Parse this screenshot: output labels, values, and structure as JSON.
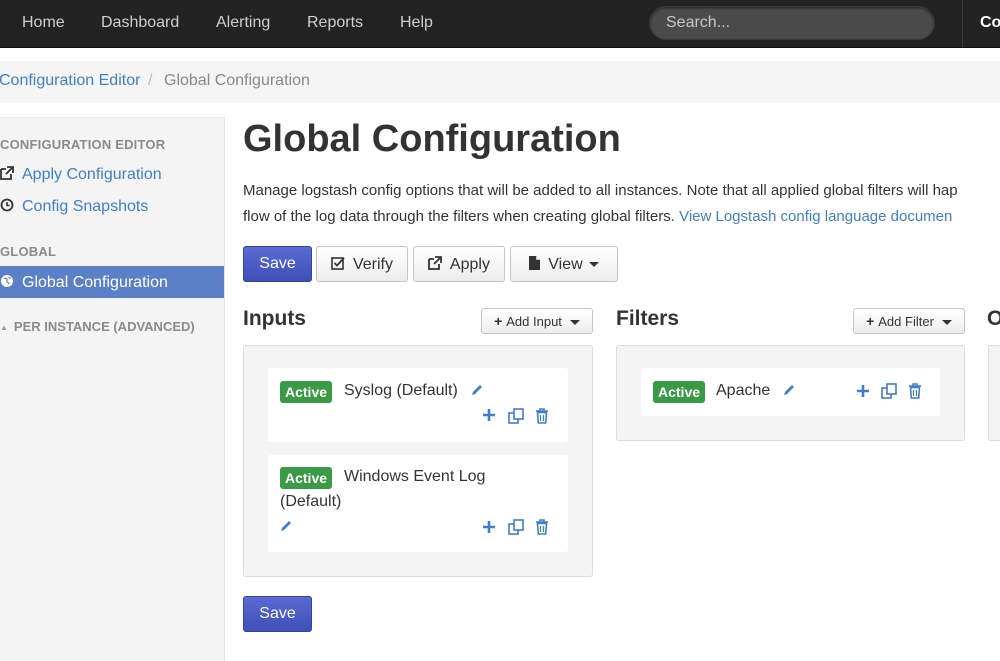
{
  "nav": {
    "items": [
      "Home",
      "Dashboard",
      "Alerting",
      "Reports",
      "Help"
    ],
    "search_placeholder": "Search...",
    "right_label": "Co"
  },
  "breadcrumb": {
    "root": "Configuration Editor",
    "separator": "/",
    "current": "Global Configuration"
  },
  "sidebar": {
    "section1": "CONFIGURATION EDITOR",
    "apply": "Apply Configuration",
    "snapshots": "Config Snapshots",
    "section2": "GLOBAL",
    "global": "Global Configuration",
    "per_instance": "PER INSTANCE (ADVANCED)"
  },
  "main": {
    "title": "Global Configuration",
    "desc_line1": "Manage logstash config options that will be added to all instances. Note that all applied global filters will hap",
    "desc_line2": "flow of the log data through the filters when creating global filters.",
    "desc_link": "View Logstash config language documen"
  },
  "toolbar": {
    "save": "Save",
    "verify": "Verify",
    "apply": "Apply",
    "view": "View"
  },
  "inputs": {
    "title": "Inputs",
    "add_label": "Add Input",
    "items": [
      {
        "status": "Active",
        "name": "Syslog (Default)"
      },
      {
        "status": "Active",
        "name_line1": "Windows Event Log",
        "name_line2": "(Default)"
      }
    ]
  },
  "filters": {
    "title": "Filters",
    "add_label": "Add Filter",
    "items": [
      {
        "status": "Active",
        "name": "Apache"
      }
    ]
  },
  "outputs": {
    "title_partial": "O"
  },
  "bottom": {
    "save": "Save"
  },
  "colors": {
    "nav_bg": "#222222",
    "primary": "#4555c0",
    "link": "#3f7fc8",
    "active_badge": "#3a9a45",
    "sidebar_active": "#5b80c7"
  },
  "icons": {
    "apply": "external-link-icon",
    "snapshots": "clock-icon",
    "global": "globe-icon",
    "per_instance": "chevron-right-icon",
    "verify": "check-square-icon",
    "view": "file-icon",
    "add": "plus-icon",
    "copy": "copy-icon",
    "delete": "trash-icon",
    "edit": "pencil-icon"
  }
}
